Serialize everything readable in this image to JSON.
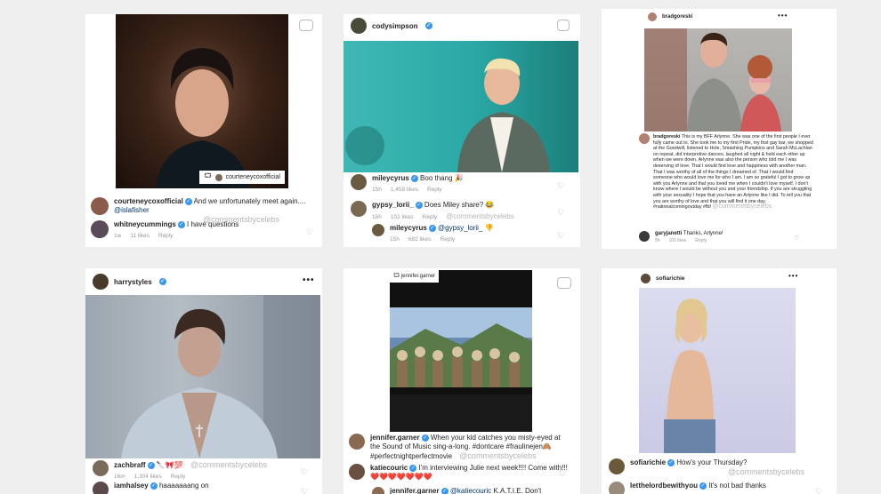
{
  "card1": {
    "tag": "courteneycoxofficial",
    "c1_user": "courteneycoxofficial",
    "c1_text": "And we unfortunately meet again....",
    "c1_mention": "@islafisher",
    "c1_wm": "@commentsbycelebs",
    "c2_user": "whitneycummings",
    "c2_text": "I have questions",
    "c2_time": "1w",
    "c2_likes": "11 likes",
    "c2_reply": "Reply"
  },
  "card2": {
    "user": "codysimpson",
    "c1_user": "mileycyrus",
    "c1_text": "Boo thang 🎉",
    "c1_time": "15h",
    "c1_likes": "1,459 likes",
    "c1_reply": "Reply",
    "c2_user": "gypsy_lorii_",
    "c2_text": "Does Miley share? 😂",
    "c2_time": "15h",
    "c2_likes": "102 likes",
    "c2_reply": "Reply",
    "c2_wm": "@commentsbycelebs",
    "c3_user": "mileycyrus",
    "c3_mention": "@gypsy_lorii_",
    "c3_text": "👎",
    "c3_time": "15h",
    "c3_likes": "682 likes",
    "c3_reply": "Reply"
  },
  "card3": {
    "user": "bradgoreski",
    "c1_user": "bradgoreski",
    "c1_text": "This is my BFF Arlynne. She was one of the first people I ever fully came out to. She took me to my first Pride, my first gay bar, we shopped at the Goodwill, listened to Hole, Smashing Pumpkins and Sarah McLachlan on repeat, did interpretive dances, laughed all night & held each other up when we were down. Arlynne was also the person who told me I was deserving of love. That I would find love and happiness with another man. That I was worthy of all of the things I dreamed of. That I would find someone who would love me for who I am. I am so grateful I got to grow up with you Arlynne and that you loved me when I couldn't love myself. I don't know where I would be without you and your friendship. If you are struggling with your sexuality I hope that you have an Arlynne like I did. To tell you that you are worthy of love and that you will find it one day. #nationalcomingoutday #fbf",
    "c1_wm": "@commentsbycelebs",
    "c2_user": "garyjanetti",
    "c2_text": "Thanks, Arlynne!",
    "c2_time": "5h",
    "c2_likes": "101 likes",
    "c2_reply": "Reply"
  },
  "card4": {
    "user": "harrystyles",
    "c1_user": "zachbraff",
    "c1_text": "🔪🎀💯",
    "c1_wm": "@commentsbycelebs",
    "c1_time": "16m",
    "c1_likes": "1,304 likes",
    "c1_reply": "Reply",
    "c2_user": "iamhalsey",
    "c2_text": "haaaaaaang on"
  },
  "card5": {
    "tag": "jennifer.garner",
    "c1_user": "jennifer.garner",
    "c1_text": "When your kid catches you misty-eyed at the Sound of Music sing-a-long. #dontcare #fraulinejen🙈 #perfectnightperfectmovie",
    "c1_wm": "@commentsbycelebs",
    "c2_user": "katiecouric",
    "c2_text": "I'm interviewing Julie next week!!!! Come with!!! ❤️❤️❤️❤️❤️❤️❤️",
    "c3_user": "jennifer.garner",
    "c3_mention": "@katiecouric",
    "c3_text": "K.A.T.I.E. Don't"
  },
  "card6": {
    "user": "sofiarichie",
    "c1_user": "sofiarichie",
    "c1_text": "How's your Thursday?",
    "c1_wm": "@commentsbycelebs",
    "c2_user": "letthelordbewithyou",
    "c2_text": "It's not bad thanks"
  },
  "colors": {
    "background": "#efefef",
    "card": "#ffffff",
    "verified": "#3897f0",
    "watermark": "#b5b5b5"
  },
  "icons": [
    "verified-icon",
    "heart-icon",
    "more-icon",
    "instagram-icon"
  ]
}
